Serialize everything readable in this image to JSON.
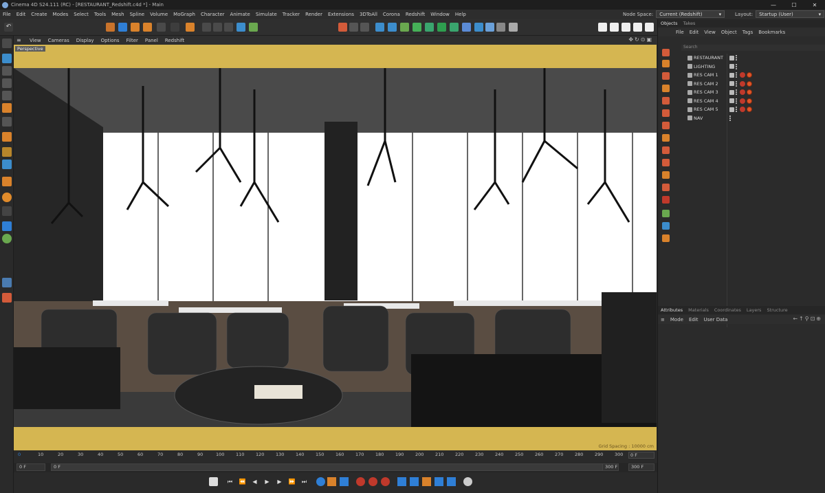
{
  "window": {
    "title": "Cinema 4D S24.111 (RC) - [RESTAURANT_Redshift.c4d *] - Main",
    "controls": [
      "—",
      "☐",
      "✕"
    ]
  },
  "menubar": {
    "items": [
      "File",
      "Edit",
      "Create",
      "Modes",
      "Select",
      "Tools",
      "Mesh",
      "Spline",
      "Volume",
      "MoGraph",
      "Character",
      "Animate",
      "Simulate",
      "Tracker",
      "Render",
      "Extensions",
      "3DToAll",
      "Corona",
      "Redshift",
      "Window",
      "Help"
    ],
    "node_space_label": "Node Space:",
    "node_space_value": "Current (Redshift)",
    "layout_label": "Layout:",
    "layout_value": "Startup (User)"
  },
  "viewport": {
    "menu": [
      "View",
      "Cameras",
      "Display",
      "Options",
      "Filter",
      "Panel",
      "Redshift"
    ],
    "camera_label": "Perspective",
    "grid_spacing": "Grid Spacing : 10000 cm"
  },
  "timeline": {
    "ticks": [
      "0",
      "10",
      "20",
      "30",
      "40",
      "50",
      "60",
      "70",
      "80",
      "90",
      "100",
      "110",
      "120",
      "130",
      "140",
      "150",
      "160",
      "170",
      "180",
      "190",
      "200",
      "210",
      "220",
      "230",
      "240",
      "250",
      "260",
      "270",
      "280",
      "290",
      "300"
    ],
    "current_frame": "0 F",
    "range_start": "0 F",
    "range_start2": "0 F",
    "range_end": "300 F",
    "range_end2": "300 F"
  },
  "objects_panel": {
    "tabs": [
      "Objects",
      "Takes"
    ],
    "menu": [
      "File",
      "Edit",
      "View",
      "Object",
      "Tags",
      "Bookmarks"
    ],
    "search_placeholder": "Search",
    "items": [
      {
        "name": "RESTAURANT",
        "tags": false
      },
      {
        "name": "LIGHTING",
        "tags": false
      },
      {
        "name": "RES CAM 1",
        "tags": true
      },
      {
        "name": "RES CAM 2",
        "tags": true
      },
      {
        "name": "RES CAM 3",
        "tags": true
      },
      {
        "name": "RES CAM 4",
        "tags": true
      },
      {
        "name": "RES CAM 5",
        "tags": true
      },
      {
        "name": "NAV",
        "tags": false
      }
    ]
  },
  "attributes_panel": {
    "tabs": [
      "Attributes",
      "Materials",
      "Coordinates",
      "Layers",
      "Structure"
    ],
    "menu": [
      "Mode",
      "Edit",
      "User Data"
    ]
  },
  "colors": {
    "accent_blue": "#2f7fd6",
    "viewport_frame": "#d5b651",
    "tag_red": "#c0392b"
  }
}
